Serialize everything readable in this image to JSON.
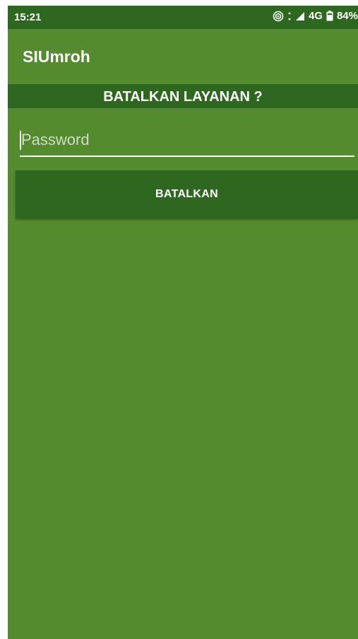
{
  "status_bar": {
    "time": "15:21",
    "network": "4G",
    "battery": "84%",
    "icons": [
      "hotspot-icon",
      "data-arrows-icon",
      "signal-icon",
      "battery-icon"
    ]
  },
  "app": {
    "title": "SIUmroh"
  },
  "banner": {
    "text": "BATALKAN LAYANAN ?"
  },
  "form": {
    "password_placeholder": "Password",
    "password_value": "",
    "submit_label": "BATALKAN"
  },
  "colors": {
    "primary": "#548b2f",
    "primary_dark": "#2e6820",
    "text": "#ffffff"
  }
}
